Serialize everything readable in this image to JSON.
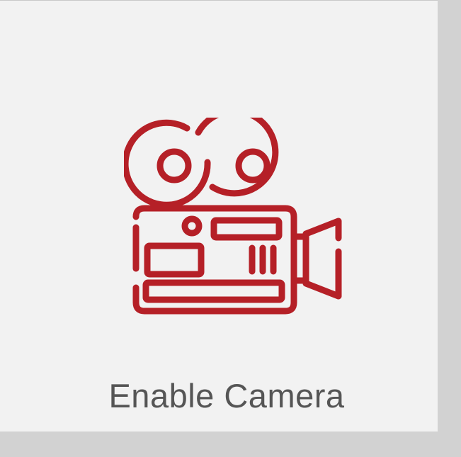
{
  "tile": {
    "label": "Enable Camera",
    "icon": "video-camera-icon",
    "accent_color": "#b52027",
    "label_color": "#555555",
    "background_color": "#f2f2f2"
  }
}
